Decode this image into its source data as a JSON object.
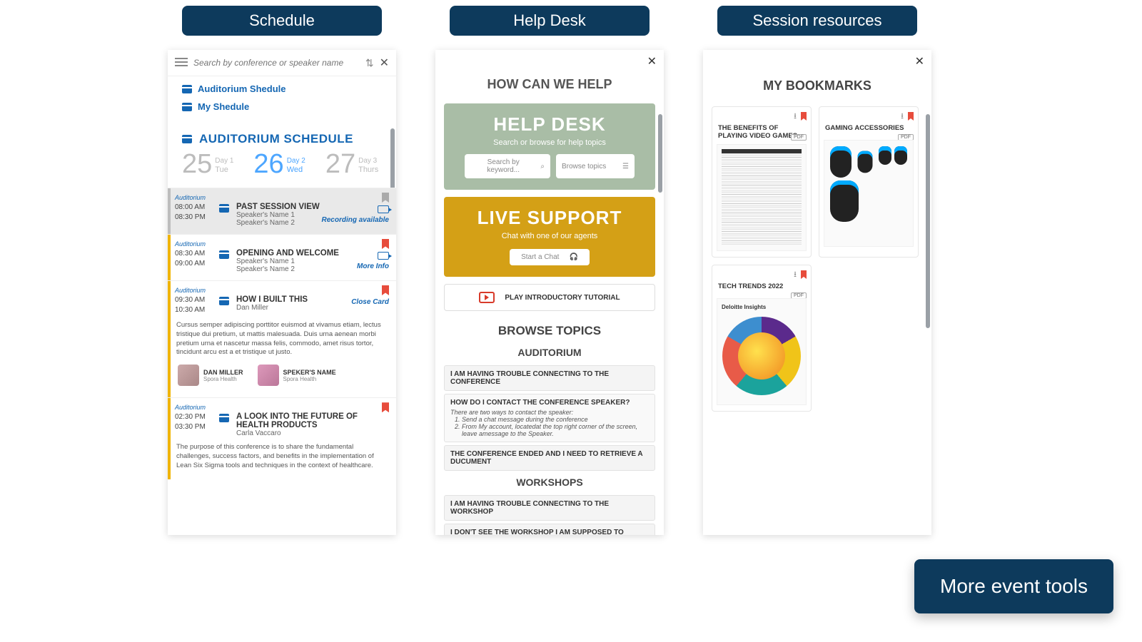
{
  "pills": {
    "schedule": "Schedule",
    "help": "Help Desk",
    "resources": "Session resources"
  },
  "float_button": "More event tools",
  "schedule": {
    "search_placeholder": "Search by conference or speaker name",
    "link_auditorium": "Auditorium Shedule",
    "link_my": "My Shedule",
    "heading": "AUDITORIUM SCHEDULE",
    "days": [
      {
        "num": "25",
        "lbl": "Day 1",
        "dow": "Tue"
      },
      {
        "num": "26",
        "lbl": "Day 2",
        "dow": "Wed"
      },
      {
        "num": "27",
        "lbl": "Day 3",
        "dow": "Thurs"
      }
    ],
    "sessions": {
      "past": {
        "loc": "Auditorium",
        "t1": "08:00 AM",
        "t2": "08:30 PM",
        "title": "PAST SESSION VIEW",
        "sp1": "Speaker's Name 1",
        "sp2": "Speaker's Name 2",
        "link": "Recording available"
      },
      "opening": {
        "loc": "Auditorium",
        "t1": "08:30 AM",
        "t2": "09:00 AM",
        "title": "OPENING AND WELCOME",
        "sp1": "Speaker's Name 1",
        "sp2": "Speaker's Name 2",
        "link": "More Info"
      },
      "built": {
        "loc": "Auditorium",
        "t1": "09:30 AM",
        "t2": "10:30 AM",
        "title": "HOW I BUILT THIS",
        "sp1": "Dan Miller",
        "link": "Close Card",
        "desc": "Cursus semper adipiscing porttitor euismod at vivamus etiam, lectus tristique dui pretium, ut mattis malesuada. Duis urna aenean morbi pretium urna et nascetur massa felis, commodo, amet risus tortor, tincidunt arcu est a et tristique ut justo.",
        "speaker1": {
          "name": "DAN MILLER",
          "org": "Spora Health"
        },
        "speaker2": {
          "name": "SPEKER'S NAME",
          "org": "Spora Health"
        }
      },
      "future": {
        "loc": "Auditorium",
        "t1": "02:30 PM",
        "t2": "03:30 PM",
        "title": "A LOOK INTO THE FUTURE OF HEALTH PRODUCTS",
        "sp1": "Carla Vaccaro",
        "desc": "The purpose of this conference is to share the fundamental challenges, success factors, and benefits in the implementation of Lean Six Sigma tools and techniques in the context of healthcare."
      }
    }
  },
  "help": {
    "title": "HOW CAN WE HELP",
    "desk_big": "HELP DESK",
    "desk_sub": "Search or browse for help topics",
    "search_ph": "Search by keyword...",
    "browse_btn": "Browse topics",
    "live_big": "LIVE SUPPORT",
    "live_sub": "Chat  with one of our agents",
    "chat_btn": "Start a Chat",
    "tutorial": "PLAY INTRODUCTORY TUTORIAL",
    "browse_h": "BROWSE TOPICS",
    "cat_auditorium": "AUDITORIUM",
    "cat_workshops": "WORKSHOPS",
    "aud_q1": "I AM HAVING TROUBLE CONNECTING TO THE CONFERENCE",
    "aud_q2": "HOW DO I CONTACT THE CONFERENCE SPEAKER?",
    "aud_q2_a": "There are two ways to contact the speaker:",
    "aud_q2_li1": "Send a chat message during the conference",
    "aud_q2_li2": "From My account, locatedat the top right corner of the screen, leave amessage to the Speaker.",
    "aud_q3": "THE CONFERENCE ENDED AND I NEED TO RETRIEVE A DUCUMENT",
    "ws_q1": "I AM HAVING TROUBLE CONNECTING TO THE WORKSHOP",
    "ws_q2": "I DON'T SEE THE WORKSHOP I AM SUPPOSED TO ATTEND"
  },
  "bookmarks": {
    "title": "MY BOOKMARKS",
    "badge": "PDF",
    "card1": "THE BENEFITS OF PLAYING VIDEO GAMES",
    "card2": "GAMING ACCESSORIES",
    "card3": "TECH TRENDS 2022",
    "brand": "Deloitte Insights"
  }
}
